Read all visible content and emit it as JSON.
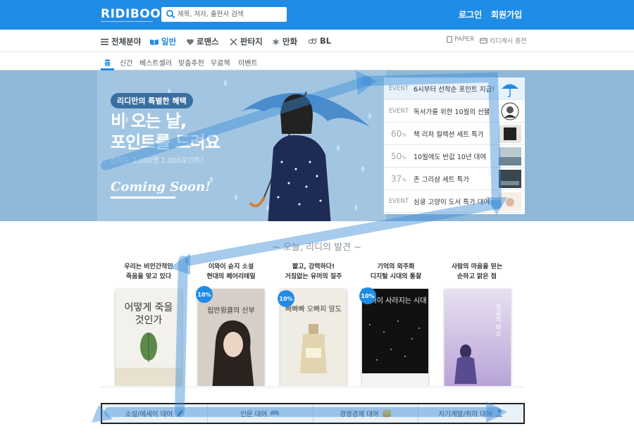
{
  "header": {
    "logo": "RIDIBOOKS",
    "search_placeholder": "제목, 저자, 출판사 검색",
    "login": "로그인",
    "signup": "회원가입"
  },
  "genre_nav": {
    "items": [
      {
        "label": "전체분야",
        "icon": "hamburger-icon"
      },
      {
        "label": "일반",
        "icon": "book-open-icon",
        "active": true
      },
      {
        "label": "로맨스",
        "icon": "heart-icon"
      },
      {
        "label": "판타지",
        "icon": "crossed-swords-icon"
      },
      {
        "label": "만화",
        "icon": "burst-icon"
      },
      {
        "label": "BL",
        "icon": "gender-icon"
      }
    ],
    "paper": "PAPER",
    "cash": "리디캐시 충전"
  },
  "sub_nav": {
    "items": [
      "홈",
      "신간",
      "베스트셀러",
      "맞춤추천",
      "무료책",
      "이벤트"
    ]
  },
  "banner": {
    "pill": "리디만의 특별한 혜택",
    "title_line1": "비 오는 날,",
    "title_line2": "포인트를 드려요",
    "subtitle": "선착순 2,000명 1,000포인트!",
    "coming": "Coming Soon!"
  },
  "events": [
    {
      "tag": "EVENT",
      "text": "6시부터 선착순 포인트 지급!",
      "thumb": "umbrella-icon",
      "selected": true
    },
    {
      "tag": "EVENT",
      "text": "독서가를 위한 10월의 선물",
      "thumb": "portrait-icon"
    },
    {
      "tag": "60",
      "unit": "%",
      "text": "책 리처 컬렉션 세트 특가",
      "thumb": "book-cover-icon"
    },
    {
      "tag": "50",
      "unit": "%",
      "text": "10월에도 반값 10년 대여",
      "thumb": "book-cover-icon"
    },
    {
      "tag": "37",
      "unit": "%",
      "text": "존 그리샴 세트 특가",
      "thumb": "book-cover-icon"
    },
    {
      "tag": "EVENT",
      "text": "심쿵 고양이 도서 특가 대여",
      "thumb": "book-cover-icon"
    }
  ],
  "discover": {
    "title": "오늘, 리디의 발견",
    "books": [
      {
        "line1": "우리는 비인간적인",
        "line2": "죽음을 맞고 있다",
        "discount": "",
        "cover_title": "어떻게 죽을것인가",
        "cover_bg": "#f3f1ec"
      },
      {
        "line1": "이와이 슌지 소설",
        "line2": "현대의 페어리테일",
        "discount": "10%",
        "cover_title": "립반윙클의 신부",
        "cover_bg": "#d6cfc8"
      },
      {
        "line1": "짧고, 강력하다!",
        "line2": "거침없는 유머의 질주",
        "discount": "10%",
        "cover_title": "빠빠빠 오빠피 말도",
        "cover_bg": "#efece4"
      },
      {
        "line1": "기억의 외주화",
        "line2": "디지털 시대의 통찰",
        "discount": "10%",
        "cover_title": "기억이 사라지는 시대",
        "cover_bg": "#111"
      },
      {
        "line1": "사람의 마음을 믿는",
        "line2": "순하고 맑은 첨",
        "discount": "",
        "cover_title": "소교의 비소",
        "cover_bg": "#c8b8e0"
      }
    ]
  },
  "categories": [
    {
      "label": "소설/에세이 대여",
      "icon": "feather-icon"
    },
    {
      "label": "인문 대여",
      "icon": "scroll-icon"
    },
    {
      "label": "경영경제 대여",
      "icon": "coins-icon"
    },
    {
      "label": "자기계발/취미 대여",
      "icon": "meditation-icon"
    }
  ]
}
